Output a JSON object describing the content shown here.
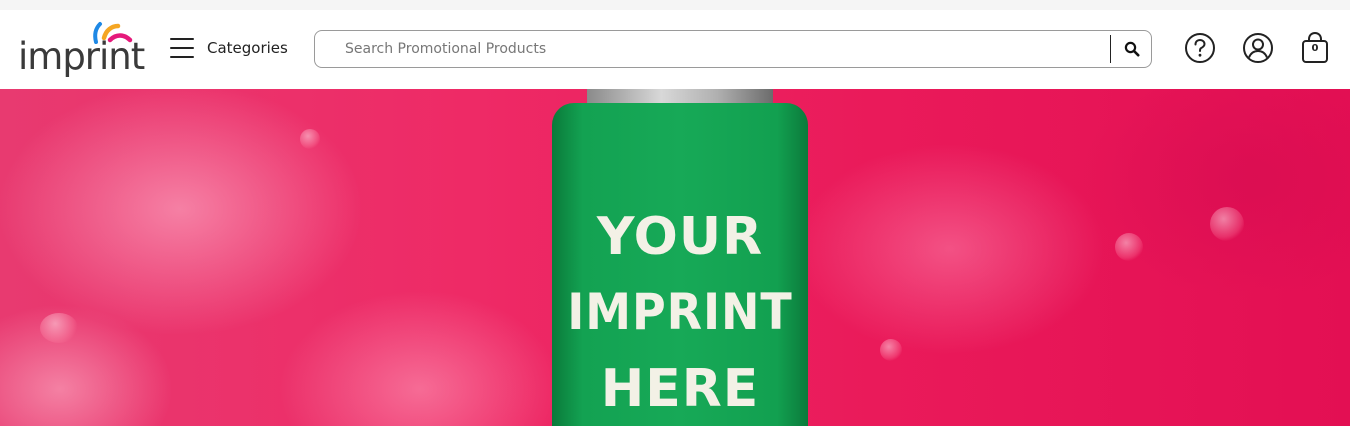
{
  "brand": {
    "logo_text": "imprint",
    "colors": {
      "blue": "#1e88e5",
      "orange": "#f5a623",
      "magenta": "#e5197a"
    }
  },
  "nav": {
    "categories_label": "Categories"
  },
  "search": {
    "placeholder": "Search Promotional Products",
    "value": ""
  },
  "header_icons": {
    "help": "question-circle-icon",
    "account": "user-circle-icon",
    "cart": "shopping-bag-icon",
    "cart_count": "0"
  },
  "hero": {
    "line1": "YOUR",
    "line2": "IMPRINT",
    "line3": "HERE",
    "background_color": "#ea1a5a",
    "product_color": "#17a957"
  }
}
